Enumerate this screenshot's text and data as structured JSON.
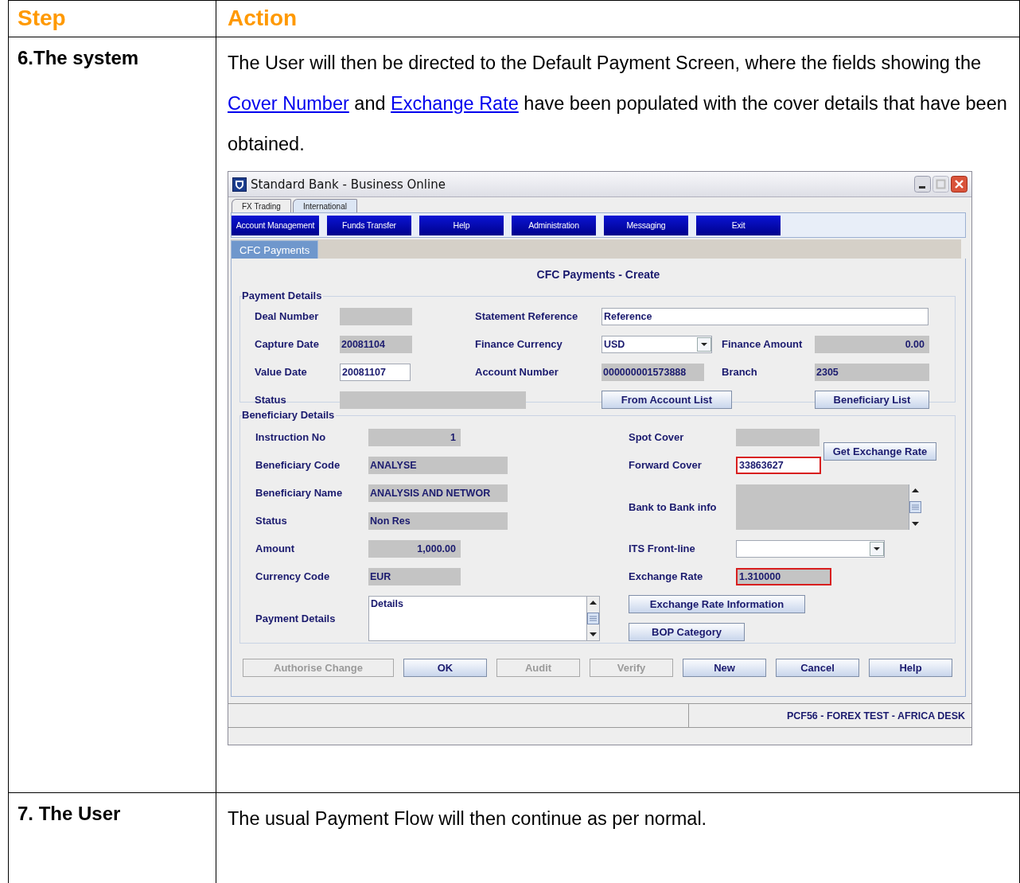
{
  "table": {
    "columns": [
      "Step",
      "Action"
    ],
    "rows": [
      {
        "step": "6.The system",
        "action": [
          {
            "kind": "text",
            "text": "The User will then be directed to the Default Payment Screen, where the fields showing the "
          },
          {
            "kind": "link",
            "text": "Cover Number"
          },
          {
            "kind": "text",
            "text": " and "
          },
          {
            "kind": "link",
            "text": "Exchange Rate"
          },
          {
            "kind": "text",
            "text": " have been populated with the cover details that have been obtained."
          }
        ],
        "window": {
          "title": "Standard Bank - Business Online",
          "tabs": [
            {
              "label": "FX Trading",
              "selected": false
            },
            {
              "label": "International",
              "selected": true
            }
          ],
          "menu": [
            "Account Management",
            "Funds Transfer",
            "Help",
            "Administration",
            "Messaging",
            "Exit"
          ],
          "subtabs": [
            {
              "label": "CFC Payments",
              "selected": true
            }
          ],
          "form_title": "CFC Payments - Create",
          "payment_details": {
            "title": "Payment Details",
            "rows": [
              [
                {
                  "kind": "label",
                  "text": "Deal Number"
                },
                {
                  "kind": "readonly"
                },
                {
                  "kind": "label",
                  "text": "Statement Reference"
                },
                {
                  "kind": "input",
                  "text": "Reference"
                }
              ],
              [
                {
                  "kind": "label",
                  "text": "Capture Date"
                },
                {
                  "kind": "readonly",
                  "text": "20081104"
                },
                {
                  "kind": "label",
                  "text": "Finance Currency"
                },
                {
                  "kind": "select",
                  "text": "USD"
                },
                {
                  "kind": "label",
                  "text": "Finance Amount"
                },
                {
                  "kind": "amount",
                  "text": "0.00"
                }
              ],
              [
                {
                  "kind": "label",
                  "text": "Value Date"
                },
                {
                  "kind": "input",
                  "text": "20081107"
                },
                {
                  "kind": "label",
                  "text": "Account Number"
                },
                {
                  "kind": "readonly",
                  "text": "000000001573888"
                },
                {
                  "kind": "label",
                  "text": "Branch"
                },
                {
                  "kind": "readonly",
                  "text": "2305"
                }
              ],
              [
                {
                  "kind": "label",
                  "text": "Status"
                },
                {
                  "kind": "readonly"
                },
                {
                  "kind": "blank"
                },
                {
                  "kind": "button",
                  "text": "From Account List"
                },
                {
                  "kind": "blank"
                },
                {
                  "kind": "button",
                  "text": "Beneficiary List"
                }
              ]
            ]
          },
          "beneficiary_details": {
            "title": "Beneficiary Details",
            "left_fields": [
              {
                "label": "Instruction No",
                "kind": "amount",
                "text": "1",
                "highlighted": false
              },
              {
                "label": "Beneficiary Code",
                "kind": "readonly",
                "text": "ANALYSE",
                "highlighted": false
              },
              {
                "label": "Beneficiary Name",
                "kind": "readonly",
                "text": "ANALYSIS AND NETWOR",
                "highlighted": false
              },
              {
                "label": "Status",
                "kind": "readonly",
                "text": "Non Res",
                "highlighted": false
              },
              {
                "label": "Amount",
                "kind": "amount",
                "text": "1,000.00",
                "highlighted": false
              },
              {
                "label": "Currency Code",
                "kind": "readonly",
                "text": "EUR",
                "highlighted": false
              },
              {
                "label": "Payment Details",
                "kind": "textarea",
                "text": "Details",
                "highlighted": false
              }
            ],
            "right_fields": [
              {
                "label": "Spot Cover",
                "kind": "readonly",
                "highlighted": false
              },
              {
                "label": "Forward Cover",
                "kind": "input",
                "text": "33863627",
                "highlighted": true
              },
              {
                "label": "Bank to Bank info",
                "kind": "readonly-textarea",
                "highlighted": false
              },
              {
                "label": "ITS Front-line",
                "kind": "select",
                "highlighted": false
              },
              {
                "label": "Exchange Rate",
                "kind": "readonly",
                "text": "1.310000",
                "highlighted": true
              }
            ],
            "side_button": "Get Exchange Rate",
            "buttons": [
              "Exchange Rate Information",
              "BOP Category"
            ]
          },
          "footer_buttons": [
            {
              "label": "Authorise Change",
              "disabled": true
            },
            {
              "label": "OK",
              "disabled": false
            },
            {
              "label": "Audit",
              "disabled": true
            },
            {
              "label": "Verify",
              "disabled": true
            },
            {
              "label": "New",
              "disabled": false
            },
            {
              "label": "Cancel",
              "disabled": false
            },
            {
              "label": "Help",
              "disabled": false
            }
          ],
          "status_bar": "PCF56 - FOREX TEST - AFRICA DESK"
        }
      },
      {
        "step": "7. The User",
        "action": [
          {
            "kind": "text",
            "text": "The usual Payment Flow will then continue as per normal."
          }
        ]
      }
    ]
  }
}
